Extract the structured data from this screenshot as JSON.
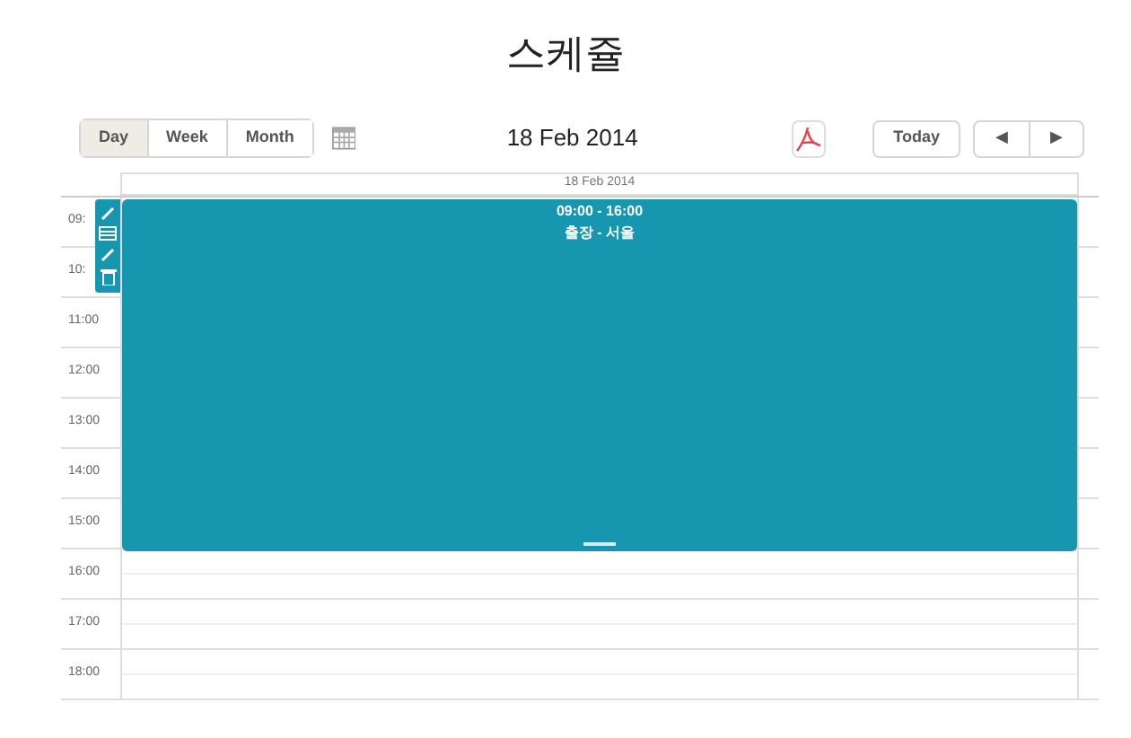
{
  "title": "스케쥴",
  "views": [
    {
      "label": "Day",
      "selected": true
    },
    {
      "label": "Week",
      "selected": false
    },
    {
      "label": "Month",
      "selected": false
    }
  ],
  "current_date": "18 Feb 2014",
  "today_button": "Today",
  "nav_buttons": [
    "◀",
    "▶"
  ],
  "day_header": "18 Feb 2014",
  "hours": [
    "09:",
    "10:",
    "11:00",
    "12:00",
    "13:00",
    "14:00",
    "15:00",
    "16:00",
    "17:00",
    "18:00"
  ],
  "event": {
    "time": "09:00 - 16:00",
    "title": "출장 - 서울"
  }
}
